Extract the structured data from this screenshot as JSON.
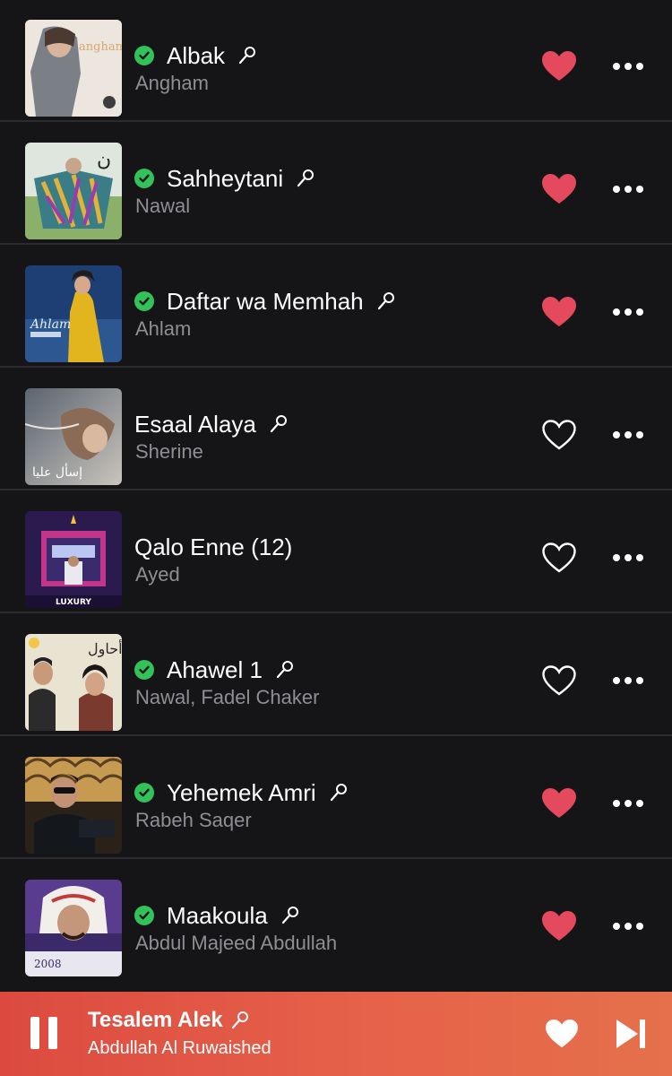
{
  "library": {
    "songs": [
      {
        "title": "Albak",
        "artist": "Angham",
        "downloaded": true,
        "lyrics": true,
        "loved": true,
        "art": "art-angham"
      },
      {
        "title": "Sahheytani",
        "artist": "Nawal",
        "downloaded": true,
        "lyrics": true,
        "loved": true,
        "art": "art-nawal"
      },
      {
        "title": "Daftar wa Memhah",
        "artist": "Ahlam",
        "downloaded": true,
        "lyrics": true,
        "loved": true,
        "art": "art-ahlam"
      },
      {
        "title": "Esaal Alaya",
        "artist": "Sherine",
        "downloaded": false,
        "lyrics": true,
        "loved": false,
        "art": "art-sherine"
      },
      {
        "title": "Qalo Enne (12)",
        "artist": "Ayed",
        "downloaded": false,
        "lyrics": false,
        "loved": false,
        "art": "art-ayed"
      },
      {
        "title": "Ahawel 1",
        "artist": "Nawal, Fadel Chaker",
        "downloaded": true,
        "lyrics": true,
        "loved": false,
        "art": "art-ahawel"
      },
      {
        "title": "Yehemek Amri",
        "artist": "Rabeh Saqer",
        "downloaded": true,
        "lyrics": true,
        "loved": true,
        "art": "art-rabeh"
      },
      {
        "title": "Maakoula",
        "artist": "Abdul Majeed Abdullah",
        "downloaded": true,
        "lyrics": true,
        "loved": true,
        "art": "art-abdulmajeed"
      }
    ]
  },
  "now_playing": {
    "title": "Tesalem Alek",
    "artist": "Abdullah Al Ruwaished",
    "playing": true,
    "loved": true
  },
  "colors": {
    "background": "#151518",
    "loved_heart": "#e5495d",
    "downloaded_badge": "#33c15a",
    "secondary_text": "#8e8e93",
    "player_gradient_start": "#dc4a3f",
    "player_gradient_end": "#e5704b"
  },
  "icons": {
    "downloaded": "checkmark-circle-icon",
    "lyrics": "microphone-icon",
    "love": "heart-icon",
    "more": "ellipsis-icon",
    "pause": "pause-icon",
    "next": "skip-forward-icon"
  }
}
